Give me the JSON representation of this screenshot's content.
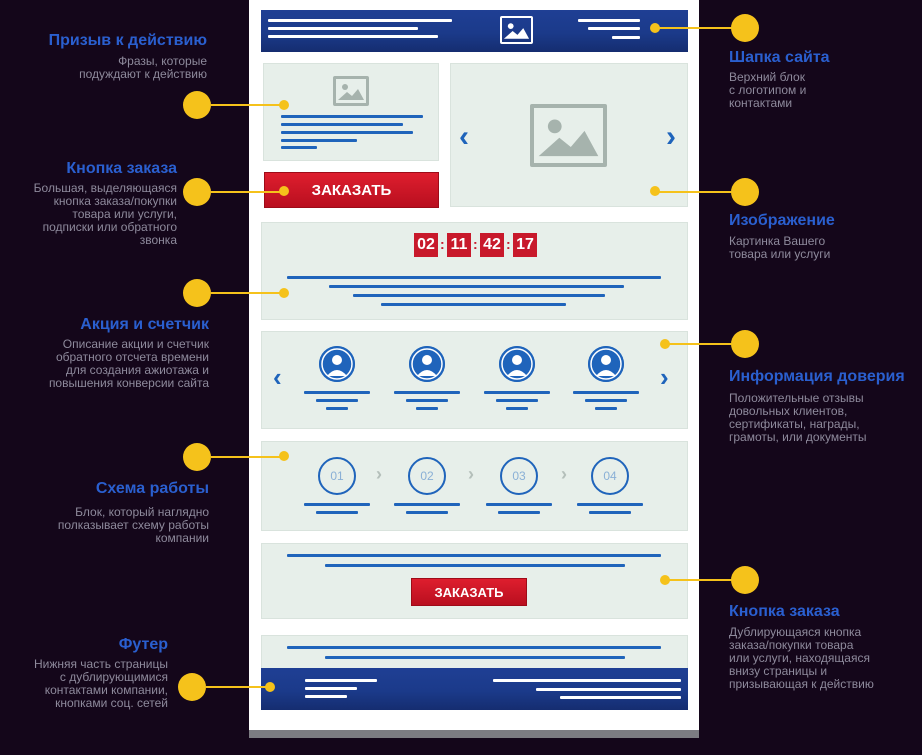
{
  "colors": {
    "background": "#14061a",
    "accent_yellow": "#f5c21b",
    "callout_title": "#2a5fcf",
    "callout_text": "#8e8a9c",
    "header_blue": "#1b3a8a",
    "wire_blue": "#1f64bb",
    "cta_red": "#c8192b",
    "block_bg": "#e7efea"
  },
  "mockup": {
    "cta_button_label": "ЗАКАЗАТЬ",
    "cta_button_bottom_label": "ЗАКАЗАТЬ",
    "timer": [
      "02",
      "11",
      "42",
      "17"
    ],
    "steps": [
      "01",
      "02",
      "03",
      "04"
    ],
    "prev_chevron": "‹",
    "next_chevron": "›",
    "step_arrow": "›"
  },
  "callouts": {
    "cta": {
      "title": "Призыв к действию",
      "desc": "Фразы, которые\nподуждают к действию"
    },
    "order_button": {
      "title": "Кнопка заказа",
      "desc": "Большая, выделяющаяся\nкнопка заказа/покупки\nтовара или услуги,\nподписки или обратного\nзвонка"
    },
    "promo": {
      "title": "Акция и счетчик",
      "desc": "Описание акции и счетчик\nобратного отсчета времени\nдля создания ажиотажа и\nповышения конверсии сайта"
    },
    "scheme": {
      "title": "Схема работы",
      "desc": "Блок, который наглядно\nполказывает схему работы\nкомпании"
    },
    "footer": {
      "title": "Футер",
      "desc": "Нижняя часть страницы\nс дублирующимися\nконтактами компании,\nкнопками соц. сетей"
    },
    "header": {
      "title": "Шапка сайта",
      "desc": "Верхний блок\nс логотипом и\nконтактами"
    },
    "image": {
      "title": "Изображение",
      "desc": "Картинка Вашего\nтовара или услуги"
    },
    "trust": {
      "title": "Информация доверия",
      "desc": "Положительные отзывы\nдовольных клиентов,\nсертификаты, награды,\nграмоты, или документы"
    },
    "order_button_bottom": {
      "title": "Кнопка заказа",
      "desc": "Дублирующаяся кнопка\nзаказа/покупки товара\nили услуги, находящаяся\nвнизу страницы и\nпризывающая к действию"
    }
  }
}
